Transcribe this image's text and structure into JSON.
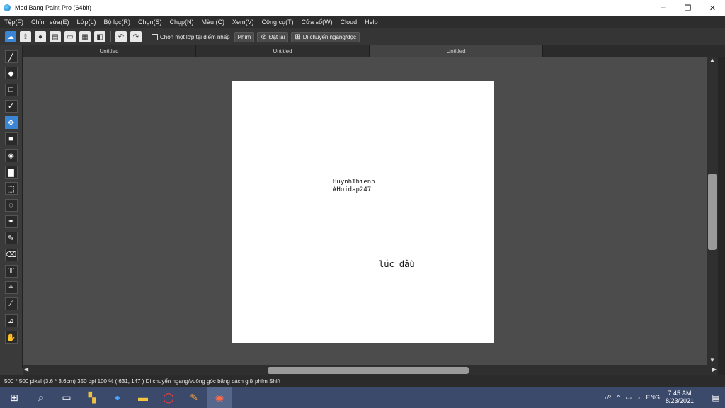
{
  "window": {
    "title": "MediBang Paint Pro (64bit)",
    "controls": {
      "minimize": "–",
      "maximize": "❐",
      "close": "✕"
    }
  },
  "menu": [
    "Tệp(F)",
    "Chỉnh sửa(E)",
    "Lớp(L)",
    "Bộ lọc(R)",
    "Chọn(S)",
    "Chụp(N)",
    "Màu (C)",
    "Xem(V)",
    "Công cụ(T)",
    "Cửa sổ(W)",
    "Cloud",
    "Help"
  ],
  "toolbar": {
    "buttons": [
      "cloud-icon",
      "upload-icon",
      "comment-icon",
      "note-icon",
      "page-icon",
      "layout-icon",
      "panel-icon"
    ],
    "undo_icon": "undo-icon",
    "redo_icon": "redo-icon",
    "select_layer_label": "Chọn một lớp tại điểm nhấp",
    "key_label": "Phím",
    "reset_label": "Đặt lại",
    "move_mode_label": "Di chuyển ngang/dọc"
  },
  "tools": [
    "brush-icon",
    "eraser-icon",
    "rect-icon",
    "line-icon",
    "move-icon",
    "fill-rect-icon",
    "bucket-icon",
    "gradient-icon",
    "select-icon",
    "lasso-icon",
    "magic-wand-icon",
    "select-pen-icon",
    "select-eraser-icon",
    "text-icon",
    "operation-icon",
    "divide-icon",
    "eyedropper-icon",
    "hand-icon"
  ],
  "tabs": [
    "Untitled",
    "Untitled",
    "Untitled"
  ],
  "canvas": {
    "line1": "HuynhThienn",
    "line2": "#Hoidap247",
    "line3": "lúc đầu"
  },
  "status": "500 * 500 pixel  (3.6 * 3.6cm)  350 dpi  100 %  ( 631, 147 )  Di chuyển ngang/vuông góc bằng cách giữ phím Shift",
  "taskbar": {
    "apps": [
      "start-icon",
      "search-icon",
      "task-view-icon",
      "network-app-icon",
      "zalo-icon",
      "file-explorer-icon",
      "opera-icon",
      "paint-icon",
      "medibang-icon"
    ],
    "tray": {
      "lang": "ENG",
      "time": "7:45 AM",
      "date": "8/23/2021"
    }
  }
}
